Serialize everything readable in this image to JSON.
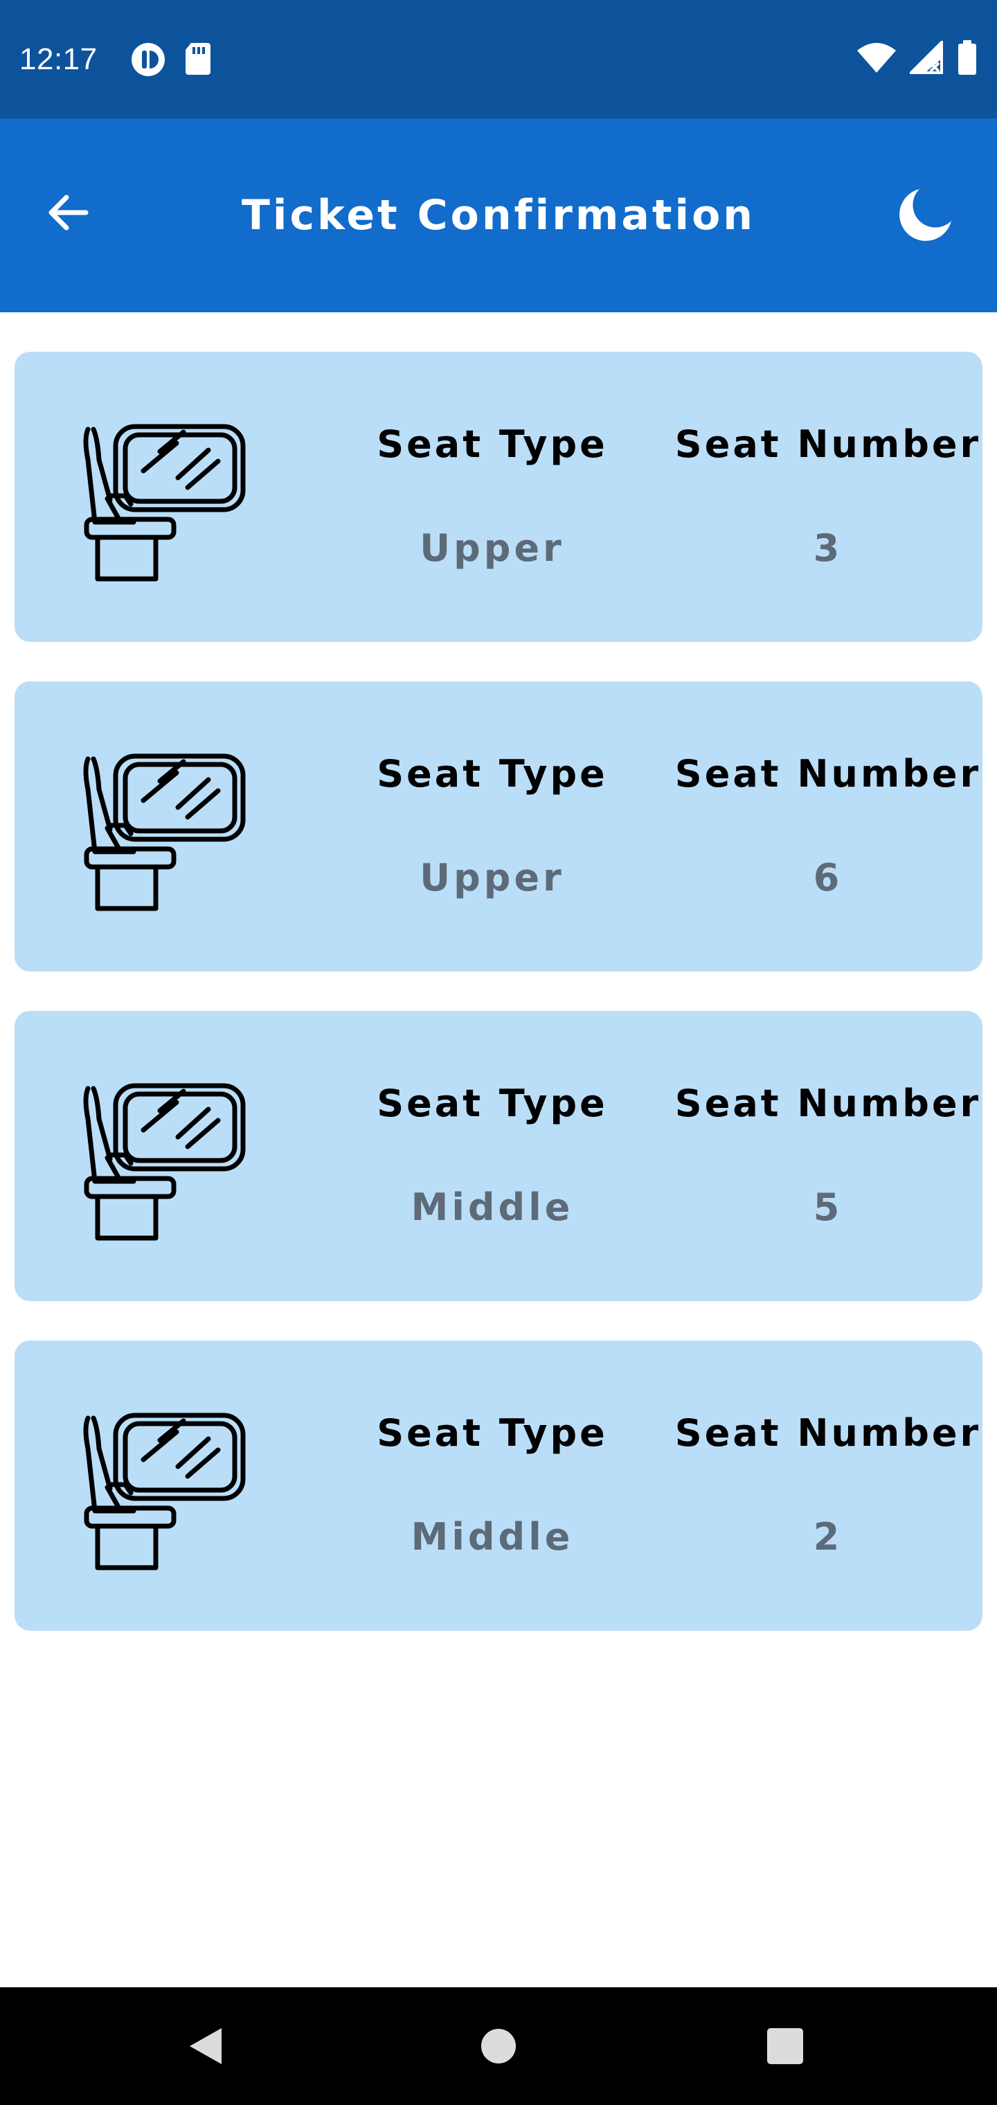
{
  "status_bar": {
    "time": "12:17",
    "icons_left": [
      "app-notification-icon",
      "sd-card-icon"
    ],
    "icons_right": [
      "wifi-icon",
      "signal-icon",
      "battery-icon"
    ],
    "background": "#0d539b"
  },
  "app_bar": {
    "title": "Ticket Confirmation",
    "back_icon": "arrow-back-icon",
    "theme_icon": "moon-icon",
    "background": "#116ccb"
  },
  "labels": {
    "seat_type": "Seat Type",
    "seat_number": "Seat Number"
  },
  "seats": [
    {
      "seat_type": "Upper",
      "seat_number": "3"
    },
    {
      "seat_type": "Upper",
      "seat_number": "6"
    },
    {
      "seat_type": "Middle",
      "seat_number": "5"
    },
    {
      "seat_type": "Middle",
      "seat_number": "2"
    }
  ],
  "card_background": "#bbdef8",
  "nav_bar": {
    "buttons": [
      "back-triangle-icon",
      "home-circle-icon",
      "recents-square-icon"
    ]
  }
}
